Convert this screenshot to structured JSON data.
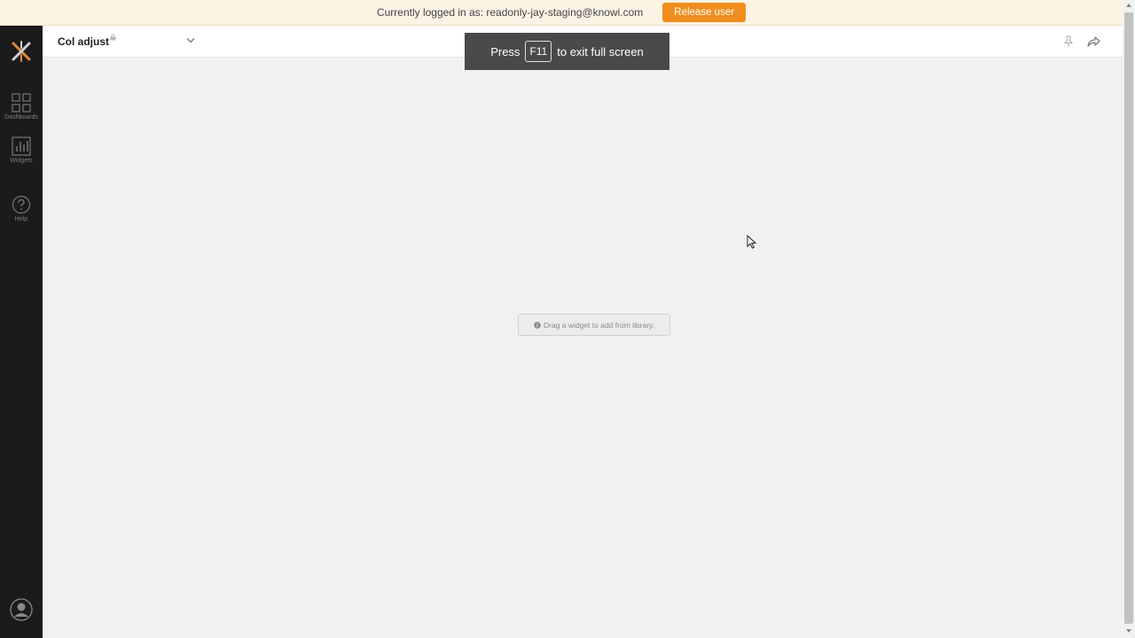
{
  "banner": {
    "text": "Currently logged in as: readonly-jay-staging@knowi.com",
    "release_label": "Release user"
  },
  "sidebar": {
    "items": [
      {
        "label": "Dashboards",
        "icon": "dashboards-grid-icon"
      },
      {
        "label": "Widgets",
        "icon": "bar-chart-icon"
      },
      {
        "label": "Help",
        "icon": "question-circle-icon"
      }
    ]
  },
  "header": {
    "title": "Col adjust"
  },
  "canvas": {
    "hint": "Drag a widget to add from library."
  },
  "fullscreen_toast": {
    "press": "Press",
    "key": "F11",
    "suffix": "to exit full screen"
  },
  "colors": {
    "accent": "#ef8e1d",
    "sidebar": "#1b1b1b",
    "banner_bg": "#fdf3e5"
  }
}
